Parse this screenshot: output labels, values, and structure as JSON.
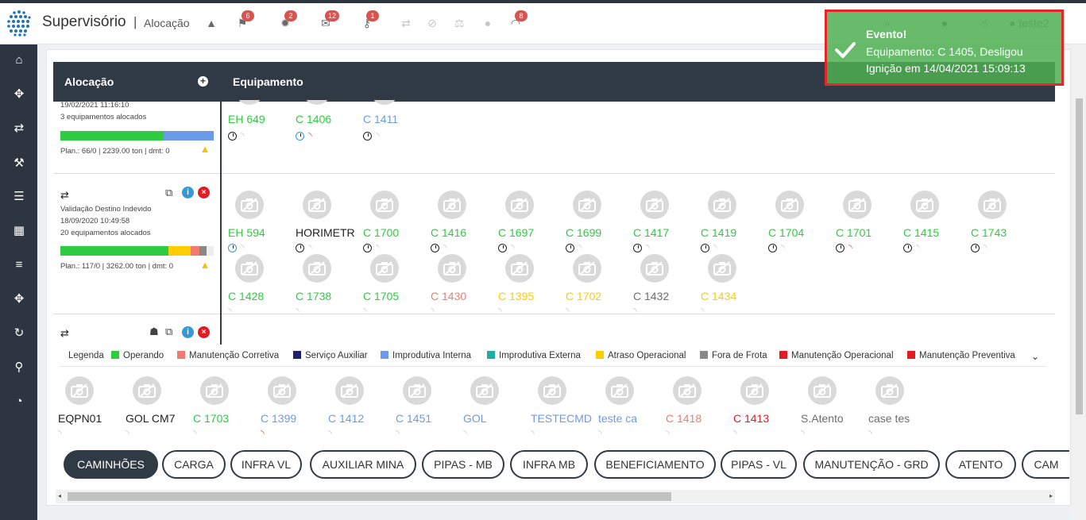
{
  "header": {
    "title": "Supervisório",
    "separator": "|",
    "subtitle": "Alocação",
    "badges": {
      "flag": "6",
      "gear": "2",
      "mail": "12",
      "wrench": "1",
      "rss": "8"
    },
    "user": "teste2"
  },
  "toast": {
    "title": "Evento!",
    "line1": "Equipamento: C 1405, Desligou",
    "line2": "Ignição em 14/04/2021 15:09:13",
    "color": "#4caf50",
    "border": "#e8232a"
  },
  "columns": {
    "allocation": "Alocação",
    "equipment": "Equipamento"
  },
  "allocations": [
    {
      "date": "19/02/2021 11:16:10",
      "count": "3 equipamentos alocados",
      "plan": "Plan.: 66/0 | 2239.00 ton | dmt: 0"
    },
    {
      "name": "Validação Destino Indevido",
      "date": "18/09/2020 10:49:58",
      "count": "20 equipamentos alocados",
      "plan": "Plan.: 117/0 | 3262.00 ton | dmt: 0"
    }
  ],
  "equipment_rows": [
    [
      "EH 649",
      "C 1406",
      "C 1411"
    ],
    [
      "EH 594",
      "HORIMETR",
      "C 1700",
      "C 1416",
      "C 1697",
      "C 1699",
      "C 1417",
      "C 1419",
      "C 1704",
      "C 1701",
      "C 1415",
      "C 1743"
    ],
    [
      "C 1428",
      "C 1738",
      "C 1705",
      "C 1430",
      "C 1395",
      "C 1702",
      "C 1432",
      "C 1434"
    ],
    [
      "EQPN01",
      "GOL CM7",
      "C 1703",
      "C 1399",
      "C 1412",
      "C 1451",
      "GOL",
      "TESTECMD",
      "teste ca",
      "C 1418",
      "C 1413",
      "S.Atento",
      "case tes"
    ]
  ],
  "legend": {
    "label": "Legenda",
    "items": [
      {
        "label": "Operando",
        "color": "#2ecc40"
      },
      {
        "label": "Manutenção Corretiva",
        "color": "#f07b6e"
      },
      {
        "label": "Serviço Auxiliar",
        "color": "#1f1f6b"
      },
      {
        "label": "Improdutiva Interna",
        "color": "#6b9be8"
      },
      {
        "label": "Improdutiva Externa",
        "color": "#1fada3"
      },
      {
        "label": "Atraso Operacional",
        "color": "#ffcc00"
      },
      {
        "label": "Fora de Frota",
        "color": "#888888"
      },
      {
        "label": "Manutenção Operacional",
        "color": "#e31b23"
      },
      {
        "label": "Manutenção Preventiva",
        "color": "#e31b23"
      }
    ]
  },
  "tabs": [
    "CAMINHÕES",
    "CARGA",
    "INFRA VL",
    "AUXILIAR MINA",
    "PIPAS - MB",
    "INFRA MB",
    "BENEFICIAMENTO",
    "PIPAS - VL",
    "MANUTENÇÃO - GRD",
    "ATENTO",
    "CAM"
  ]
}
